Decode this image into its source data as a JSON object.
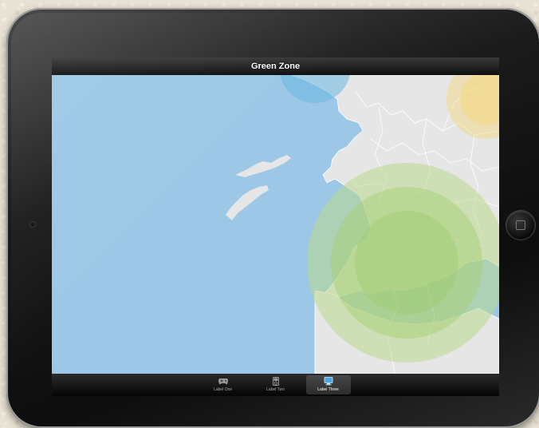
{
  "nav": {
    "title": "Green Zone"
  },
  "tabs": [
    {
      "label": "Label One",
      "icon": "gamepad-icon",
      "selected": false
    },
    {
      "label": "Label Two",
      "icon": "ipod-icon",
      "selected": false
    },
    {
      "label": "Label Three",
      "icon": "computer-icon",
      "selected": true
    }
  ],
  "colors": {
    "sea": "#9cc7e6",
    "land": "#e6e6e6",
    "green_zone": "#b9d98c",
    "yellow_zone": "#f5d77a",
    "blue_zone": "#6ab6e0"
  }
}
